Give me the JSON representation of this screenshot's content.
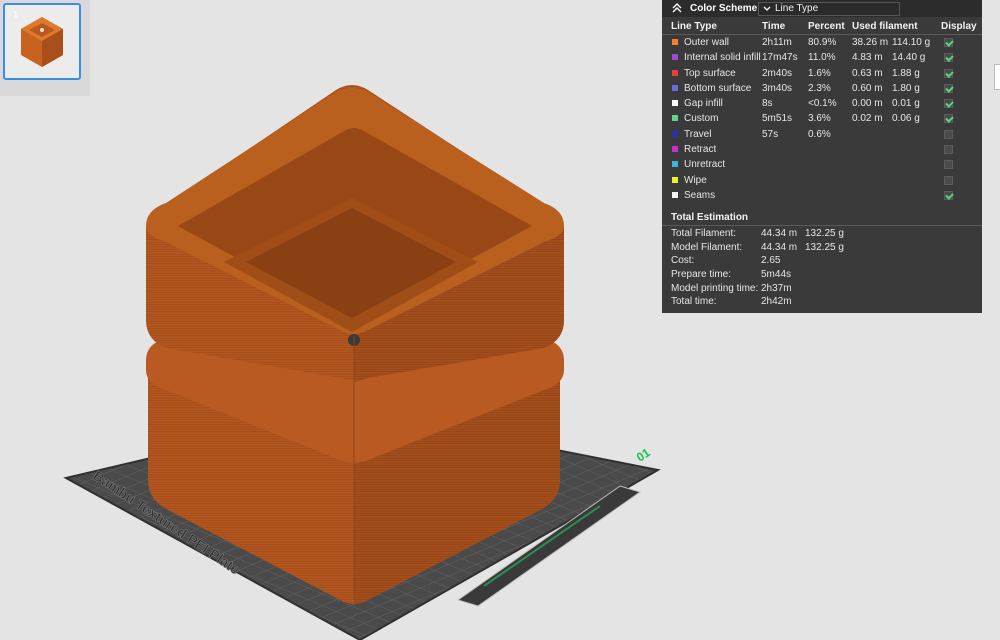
{
  "thumbnail": {
    "index": "1"
  },
  "legend": {
    "scheme_label": "Color Scheme",
    "scheme_value": "Line Type",
    "columns": [
      "Line Type",
      "Time",
      "Percent",
      "Used filament",
      "Display"
    ],
    "rows": [
      {
        "type": "Outer wall",
        "color": "#ff7b2a",
        "time": "2h11m",
        "percent": "80.9%",
        "length": "38.26 m",
        "weight": "114.10 g",
        "display": true
      },
      {
        "type": "Internal solid infill",
        "color": "#9b4dd6",
        "time": "17m47s",
        "percent": "11.0%",
        "length": "4.83 m",
        "weight": "14.40 g",
        "display": true
      },
      {
        "type": "Top surface",
        "color": "#e84040",
        "time": "2m40s",
        "percent": "1.6%",
        "length": "0.63 m",
        "weight": "1.88 g",
        "display": true
      },
      {
        "type": "Bottom surface",
        "color": "#6a6ad6",
        "time": "3m40s",
        "percent": "2.3%",
        "length": "0.60 m",
        "weight": "1.80 g",
        "display": true
      },
      {
        "type": "Gap infill",
        "color": "#ffffff",
        "time": "8s",
        "percent": "<0.1%",
        "length": "0.00 m",
        "weight": "0.01 g",
        "display": true
      },
      {
        "type": "Custom",
        "color": "#5ed68e",
        "time": "5m51s",
        "percent": "3.6%",
        "length": "0.02 m",
        "weight": "0.06 g",
        "display": true
      },
      {
        "type": "Travel",
        "color": "#2d2db8",
        "time": "57s",
        "percent": "0.6%",
        "length": "",
        "weight": "",
        "display": false
      },
      {
        "type": "Retract",
        "color": "#d02bd0",
        "time": "",
        "percent": "",
        "length": "",
        "weight": "",
        "display": false
      },
      {
        "type": "Unretract",
        "color": "#3fb4d8",
        "time": "",
        "percent": "",
        "length": "",
        "weight": "",
        "display": false
      },
      {
        "type": "Wipe",
        "color": "#f0f020",
        "time": "",
        "percent": "",
        "length": "",
        "weight": "",
        "display": false
      },
      {
        "type": "Seams",
        "color": "#f2f2f2",
        "time": "",
        "percent": "",
        "length": "",
        "weight": "",
        "display": true
      }
    ],
    "total_title": "Total Estimation",
    "totals": [
      {
        "label": "Total Filament:",
        "v1": "44.34 m",
        "v2": "132.25 g"
      },
      {
        "label": "Model Filament:",
        "v1": "44.34 m",
        "v2": "132.25 g"
      },
      {
        "label": "Cost:",
        "v1": "2.65",
        "v2": ""
      },
      {
        "label": "Prepare time:",
        "v1": "5m44s",
        "v2": ""
      },
      {
        "label": "Model printing time:",
        "v1": "2h37m",
        "v2": ""
      },
      {
        "label": "Total time:",
        "v1": "2h42m",
        "v2": ""
      }
    ]
  },
  "plate": {
    "label": "Bambu Textured PEI Plate",
    "plate_number": "01"
  },
  "model": {
    "color": "#b3561f"
  }
}
